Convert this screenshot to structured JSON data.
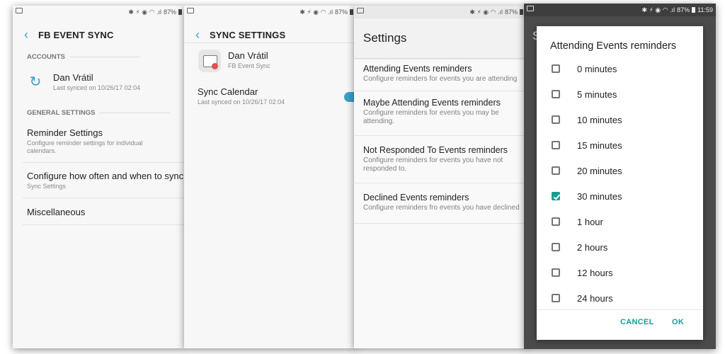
{
  "status": {
    "battery": "87%",
    "time": "11:59"
  },
  "panel1": {
    "title": "FB EVENT SYNC",
    "accounts_header": "ACCOUNTS",
    "account": {
      "name": "Dan Vrátil",
      "last_synced": "Last synced on 10/26/17 02:04"
    },
    "general_header": "GENERAL SETTINGS",
    "items": [
      {
        "title": "Reminder Settings",
        "subtitle": "Configure reminder settings for individual calendars."
      },
      {
        "title": "Configure how often and when to sync.",
        "subtitle": "Sync Settings"
      },
      {
        "title": "Miscellaneous",
        "subtitle": ""
      }
    ]
  },
  "panel2": {
    "title": "SYNC SETTINGS",
    "account": {
      "name": "Dan Vrátil",
      "app": "FB Event Sync"
    },
    "sync_calendar": {
      "title": "Sync Calendar",
      "subtitle": "Last synced on 10/26/17 02:04",
      "enabled": true
    }
  },
  "panel3": {
    "title": "Settings",
    "items": [
      {
        "title": "Attending Events reminders",
        "subtitle": "Configure reminders for events you are attending"
      },
      {
        "title": "Maybe Attending Events reminders",
        "subtitle": "Configure reminders for events you may be attending."
      },
      {
        "title": "Not Responded To Events reminders",
        "subtitle": "Configure reminders for events you have not responded to."
      },
      {
        "title": "Declined Events reminders",
        "subtitle": "Configure reminders fro events you have declined"
      }
    ]
  },
  "panel4": {
    "background_title": "S",
    "dialog": {
      "title": "Attending Events reminders",
      "options": [
        {
          "label": "0 minutes",
          "checked": false
        },
        {
          "label": "5 minutes",
          "checked": false
        },
        {
          "label": "10 minutes",
          "checked": false
        },
        {
          "label": "15 minutes",
          "checked": false
        },
        {
          "label": "20 minutes",
          "checked": false
        },
        {
          "label": "30 minutes",
          "checked": true
        },
        {
          "label": "1 hour",
          "checked": false
        },
        {
          "label": "2 hours",
          "checked": false
        },
        {
          "label": "12 hours",
          "checked": false
        },
        {
          "label": "24 hours",
          "checked": false
        }
      ],
      "cancel_label": "CANCEL",
      "ok_label": "OK"
    }
  },
  "colors": {
    "accent_blue": "#3aa0c8",
    "accent_teal": "#159e94"
  }
}
